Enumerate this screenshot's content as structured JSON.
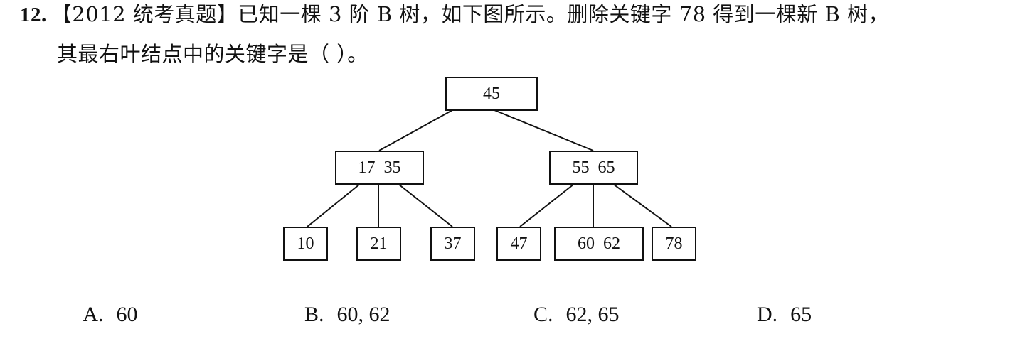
{
  "question": {
    "number": "12.",
    "line1": "【2012 统考真题】已知一棵 3 阶 B 树，如下图所示。删除关键字 78 得到一棵新 B 树，",
    "line2": "其最右叶结点中的关键字是（   ）。"
  },
  "tree": {
    "root": "45",
    "internal": [
      "17  35",
      "55  65"
    ],
    "leaves": [
      "10",
      "21",
      "37",
      "47",
      "60  62",
      "78"
    ]
  },
  "options": [
    {
      "letter": "A.",
      "text": "60"
    },
    {
      "letter": "B.",
      "text": "60, 62"
    },
    {
      "letter": "C.",
      "text": "62, 65"
    },
    {
      "letter": "D.",
      "text": "65"
    }
  ]
}
